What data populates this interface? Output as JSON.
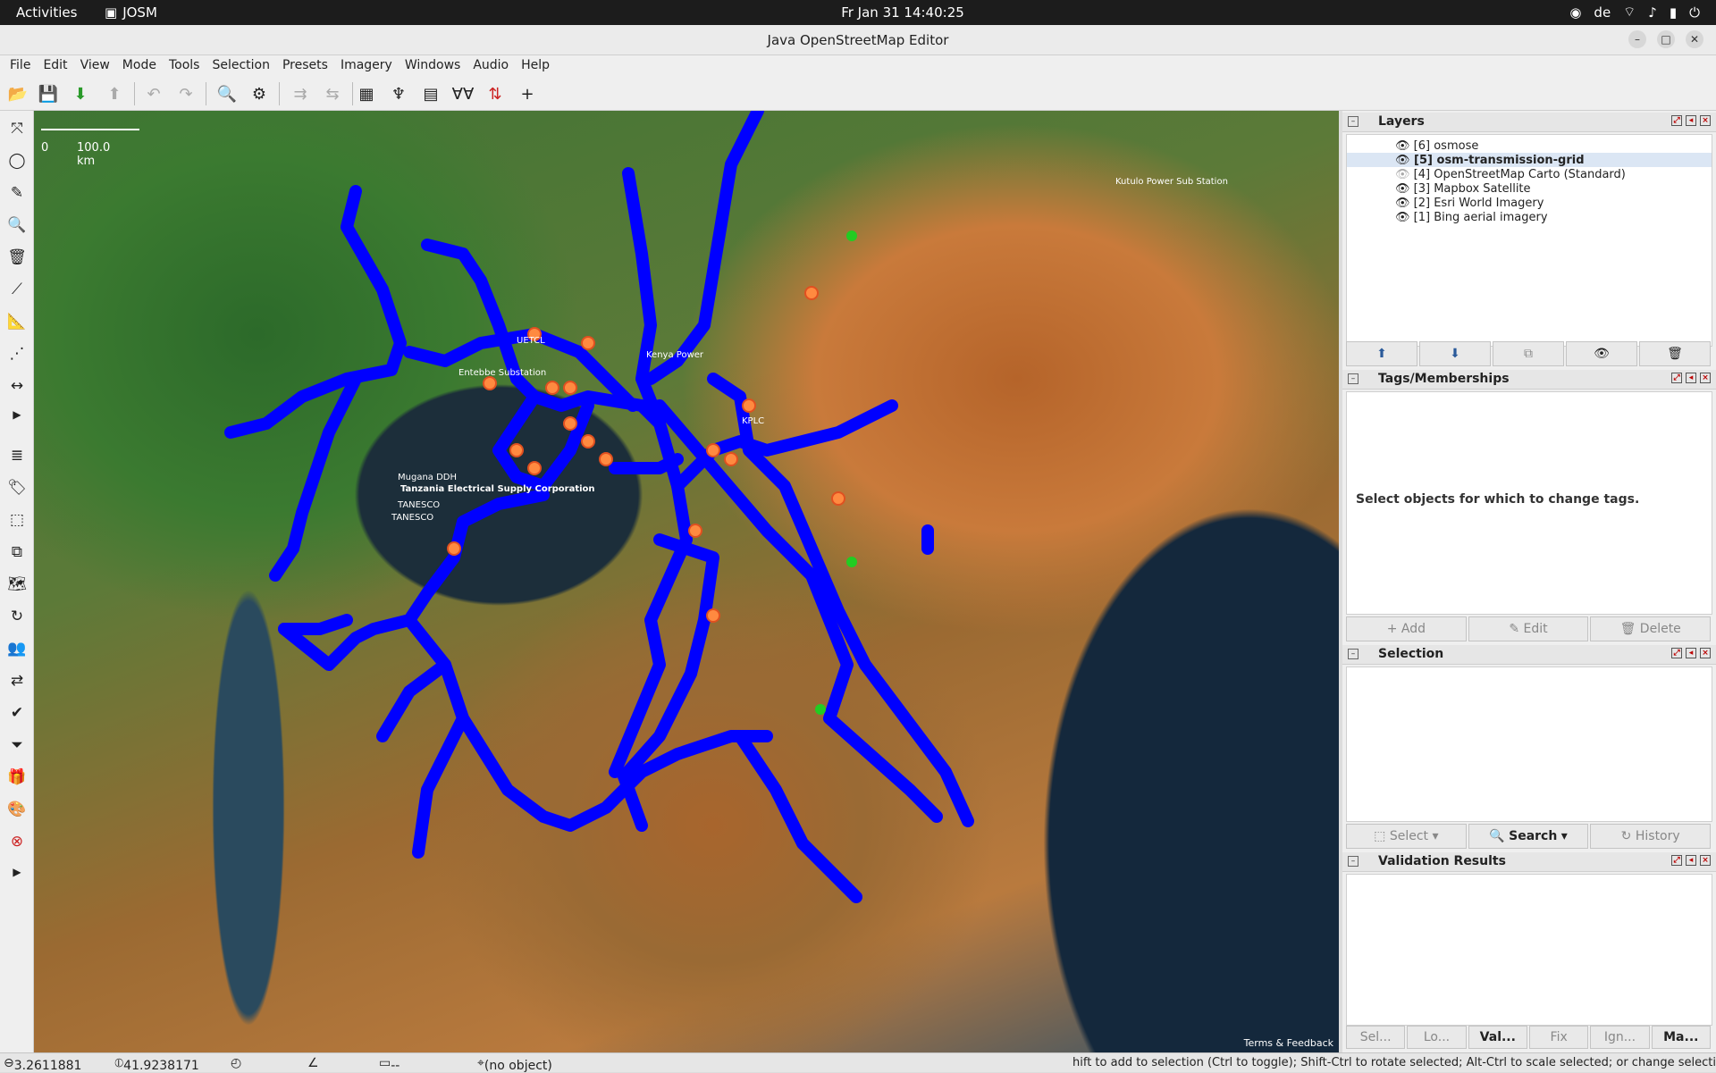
{
  "topbar": {
    "activities": "Activities",
    "app": "JOSM",
    "clock": "Fr Jan 31  14:40:25",
    "lang": "de"
  },
  "window": {
    "title": "Java OpenStreetMap Editor"
  },
  "menu": [
    "File",
    "Edit",
    "View",
    "Mode",
    "Tools",
    "Selection",
    "Presets",
    "Imagery",
    "Windows",
    "Audio",
    "Help"
  ],
  "map": {
    "scale_zero": "0",
    "scale_label": "100.0 km",
    "terms": "Terms & Feedback",
    "labels": [
      "Kutulo Power Sub Station",
      "Entebbe Substation",
      "Kenya Power",
      "UETCL",
      "KPLC",
      "Mugana DDH",
      "Tanzania Electrical Supply Corporation",
      "TANESCO",
      "TANESCO"
    ]
  },
  "layers": {
    "title": "Layers",
    "items": [
      {
        "num": "[6]",
        "name": "osmose",
        "bold": false
      },
      {
        "num": "[5]",
        "name": "osm-transmission-grid",
        "bold": true
      },
      {
        "num": "[4]",
        "name": "OpenStreetMap Carto (Standard)",
        "bold": false
      },
      {
        "num": "[3]",
        "name": "Mapbox Satellite",
        "bold": false
      },
      {
        "num": "[2]",
        "name": "Esri World Imagery",
        "bold": false
      },
      {
        "num": "[1]",
        "name": "Bing aerial imagery",
        "bold": false
      }
    ]
  },
  "tags": {
    "title": "Tags/Memberships",
    "hint": "Select objects for which to change tags.",
    "add": "Add",
    "edit": "Edit",
    "delete": "Delete"
  },
  "selection": {
    "title": "Selection",
    "select": "Select",
    "search": "Search",
    "history": "History"
  },
  "validation": {
    "title": "Validation Results",
    "tabs": [
      "Sel...",
      "Lo...",
      "Val...",
      "Fix",
      "Ign...",
      "Ma..."
    ]
  },
  "status": {
    "lat": "3.2611881",
    "lon": "41.9238171",
    "angle": "",
    "dist": "--",
    "object": "(no object)",
    "hint": "hift to add to selection (Ctrl to toggle); Shift-Ctrl to rotate selected; Alt-Ctrl to scale selected; or change selection"
  }
}
